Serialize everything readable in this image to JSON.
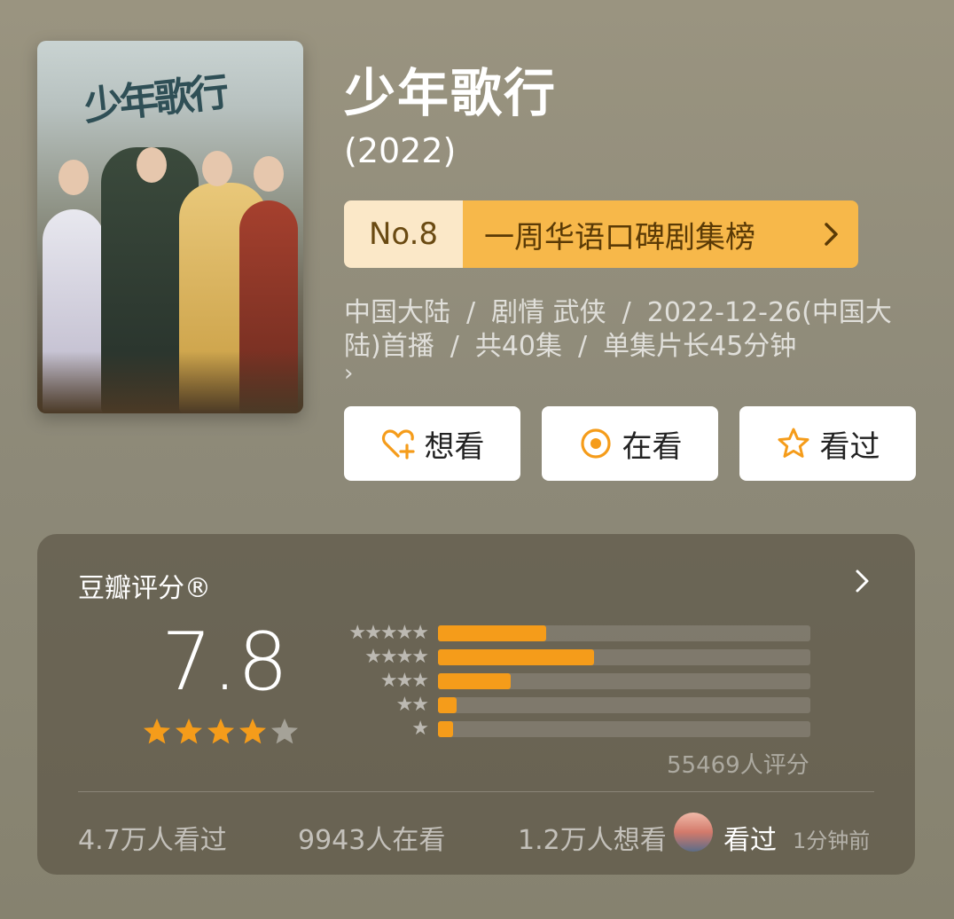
{
  "poster": {
    "title_text": "少年歌行"
  },
  "header": {
    "title": "少年歌行",
    "year": "(2022)"
  },
  "ranking": {
    "number": "No.8",
    "name": "一周华语口碑剧集榜"
  },
  "meta": {
    "region": "中国大陆",
    "genres": "剧情  武侠",
    "premiere": "2022-12-26(中国大陆)首播",
    "episodes": "共40集",
    "duration": "单集片长45分钟",
    "more": "›"
  },
  "actions": {
    "want": "想看",
    "watching": "在看",
    "watched": "看过"
  },
  "rating": {
    "title": "豆瓣评分®",
    "score": "7.8",
    "stars": 4,
    "count_text": "55469人评分",
    "distribution": [
      {
        "stars": "★★★★★",
        "percent": 29
      },
      {
        "stars": "★★★★",
        "percent": 42
      },
      {
        "stars": "★★★",
        "percent": 19.5
      },
      {
        "stars": "★★",
        "percent": 5
      },
      {
        "stars": "★",
        "percent": 4
      }
    ]
  },
  "stats": {
    "watched": "4.7万人看过",
    "watching": "9943人在看",
    "want": "1.2万人想看",
    "recent_action": "看过",
    "recent_time": "1分钟前"
  },
  "colors": {
    "accent": "#f59c1a",
    "rank_bg": "#f7b84a",
    "rank_no_bg": "#fbe8c8",
    "icon": "#f59c1a"
  }
}
